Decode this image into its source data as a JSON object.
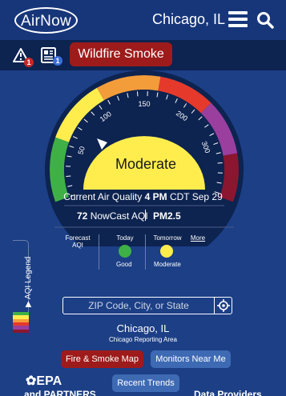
{
  "header": {
    "logo": "AirNow",
    "location": "Chicago, IL"
  },
  "subbar": {
    "alert_count": "1",
    "news_count": "1",
    "smoke_button": "Wildfire Smoke"
  },
  "gauge": {
    "category": "Moderate",
    "ticks": [
      "50",
      "100",
      "150",
      "200",
      "300"
    ],
    "pointer_aqi": 72,
    "colors": {
      "good": "#3fb046",
      "moderate": "#ffed4e",
      "usg": "#f39c3a",
      "unhealthy": "#e53a2b",
      "very_unhealthy": "#9b3f9e",
      "hazardous": "#8a1630"
    }
  },
  "current": {
    "label": "Current Air Quality",
    "time": "4 PM",
    "tz_date": "CDT Sep 29",
    "aqi_value": "72",
    "aqi_label": "NowCast AQI",
    "pollutant": "PM2.5"
  },
  "forecast": {
    "label_line1": "Forecast",
    "label_line2": "AQI",
    "today_label": "Today",
    "today_category": "Good",
    "tomorrow_label": "Tomorrow",
    "tomorrow_category": "Moderate",
    "more": "More"
  },
  "legend": {
    "label": "AQI Legend"
  },
  "search": {
    "placeholder": "ZIP Code, City, or State"
  },
  "reporting": {
    "city": "Chicago, IL",
    "area": "Chicago Reporting Area"
  },
  "buttons": {
    "fire_map": "Fire & Smoke Map",
    "monitors": "Monitors Near Me",
    "trends": "Recent Trends"
  },
  "footer": {
    "epa": "EPA",
    "partners": "and PARTNERS",
    "providers": "Data Providers"
  }
}
